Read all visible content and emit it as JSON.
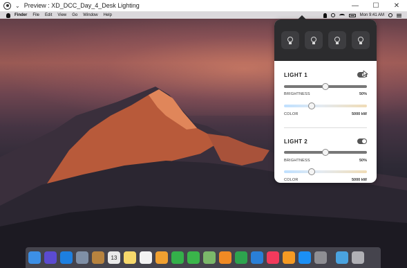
{
  "window": {
    "title": "Preview : XD_DCC_Day_4_Desk Lighting",
    "minimize": "—",
    "maximize": "☐",
    "close": "✕"
  },
  "menubar": {
    "items": [
      "Finder",
      "File",
      "Edit",
      "View",
      "Go",
      "Window",
      "Help"
    ],
    "time": "Mon 9:41 AM"
  },
  "popover": {
    "bulb_icons": [
      "bulb-icon",
      "bulb-icon",
      "bulb-icon",
      "bulb-icon"
    ],
    "lights": [
      {
        "title": "LIGHT 1",
        "toggle_on": true,
        "brightness_label": "BRIGHTNESS",
        "brightness_value": "50%",
        "brightness_level": 0.5,
        "color_label": "COLOR",
        "color_value": "5000 kW",
        "color_level": 0.33
      },
      {
        "title": "LIGHT 2",
        "toggle_on": true,
        "brightness_label": "BRIGHTNESS",
        "brightness_value": "50%",
        "brightness_level": 0.5,
        "color_label": "COLOR",
        "color_value": "5000 kW",
        "color_level": 0.33
      }
    ]
  },
  "dock": {
    "calendar_day": "13",
    "icons": [
      "finder-icon",
      "siri-icon",
      "safari-icon",
      "rocket-icon",
      "contacts-icon",
      "calendar-icon",
      "notes-icon",
      "reminders-icon",
      "photos-icon",
      "facetime-icon",
      "messages-icon",
      "maps-icon",
      "pages-icon",
      "numbers-icon",
      "keynote-icon",
      "music-icon",
      "books-icon",
      "appstore-icon",
      "settings-icon",
      "folder-icon",
      "trash-icon"
    ],
    "colors": [
      "#3c8fe6",
      "#5b4bd1",
      "#1d7fe0",
      "#7f8fa6",
      "#b7833f",
      "#e9e9e9",
      "#f6d86b",
      "#f2f2f2",
      "#f0a030",
      "#34b04a",
      "#3ab54a",
      "#7bb86a",
      "#f08a24",
      "#2da44e",
      "#2a7fd6",
      "#f23a5c",
      "#f59a23",
      "#1b8ff5",
      "#8e8e93",
      "#4aa3df",
      "#b0b0b5"
    ]
  }
}
